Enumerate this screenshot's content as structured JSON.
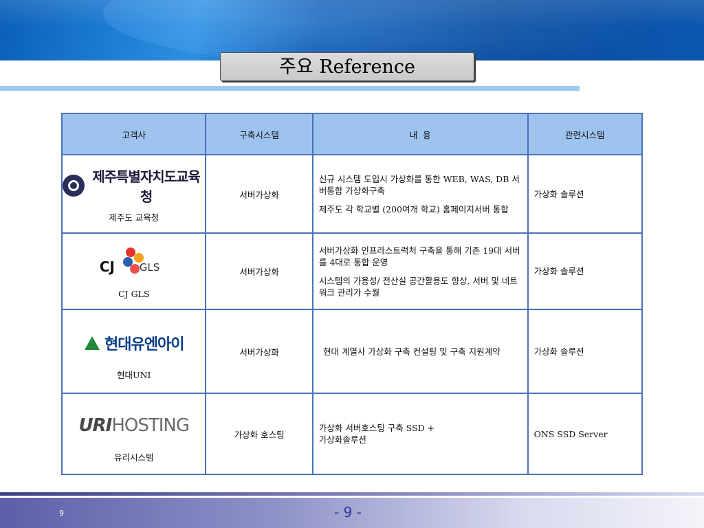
{
  "slide": {
    "title": "주요 Reference",
    "page_number_small": "9",
    "page_number_center": "- 9 -"
  },
  "table": {
    "headers": [
      "고객사",
      "구축시스템",
      "내  용",
      "관련시스템"
    ],
    "rows": [
      {
        "logo": "jeju-education-office-logo",
        "logo_text": "제주특별자치도교육청",
        "customer": "제주도 교육청",
        "system": "서버가상화",
        "content": [
          "신규 시스템 도입시 가상화를 통한 WEB, WAS, DB 서버통합 가상화구축",
          "제주도 각 학교별 (200여개 학교) 홈페이지서버 통합"
        ],
        "related": "가상화 솔루션"
      },
      {
        "logo": "cj-gls-logo",
        "logo_text": "CJ GLS",
        "customer": "CJ GLS",
        "system": "서버가상화",
        "content": [
          "서버가상화 인프라스트럭처 구축을 통해 기존 19대 서버를 4대로 통합 운영",
          "시스템의 가용성/ 전산실 공간활용도 향상, 서버 및 네트워크 관리가 수월"
        ],
        "related": "가상화 솔루션"
      },
      {
        "logo": "hyundai-uni-logo",
        "logo_text": "현대유엔아이",
        "customer": "현대UNI",
        "system": "서버가상화",
        "content": [
          "현대 계열사 가상화 구축 컨설팅 및 구축 지원계약"
        ],
        "related": "가상화 솔루션"
      },
      {
        "logo": "urihosting-logo",
        "logo_text": "URIHOSTING",
        "customer": "유리시스템",
        "system": "가상화 호스팅",
        "content": [
          "가상화 서버호스팅 구축 SSD +  가상화솔루션"
        ],
        "related": "ONS SSD Server"
      }
    ]
  },
  "colors": {
    "header_band": "#0a4a9c",
    "table_header_bg": "#9ec3ef",
    "table_border": "#4a72b8",
    "title_box_bg": "#d0d0d0"
  }
}
